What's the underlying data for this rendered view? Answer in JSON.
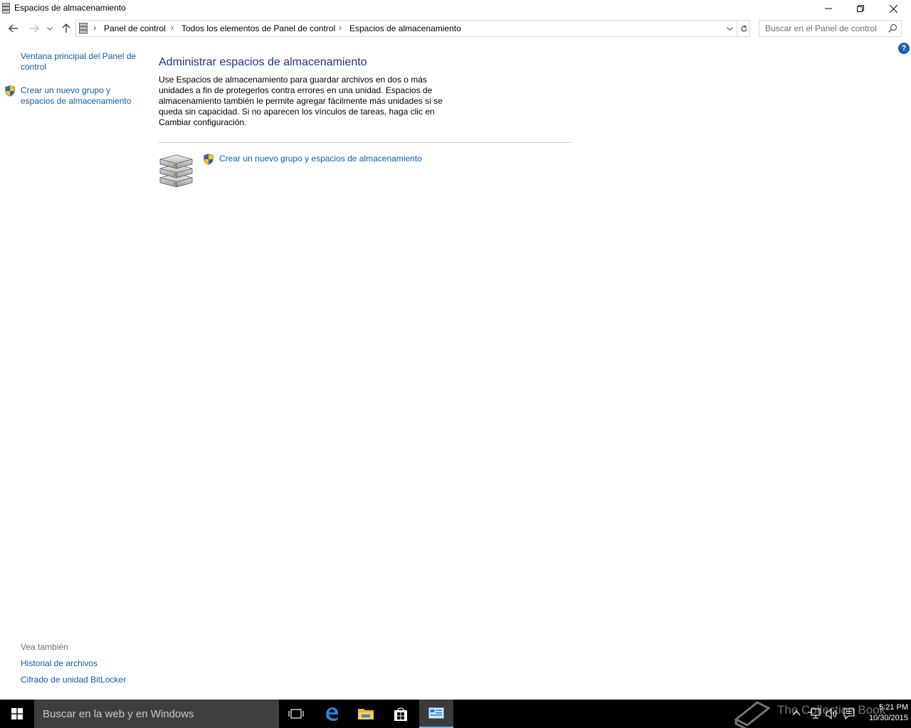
{
  "window": {
    "title": "Espacios de almacenamiento",
    "icon": "storage-spaces-icon"
  },
  "address": {
    "crumbs": [
      "Panel de control",
      "Todos los elementos de Panel de control",
      "Espacios de almacenamiento"
    ],
    "search_placeholder": "Buscar en el Panel de control"
  },
  "left_pane": {
    "home_link": "Ventana principal del Panel de control",
    "create_link": "Crear un nuevo grupo y espacios de almacenamiento",
    "see_also_heading": "Vea también",
    "see_also": [
      "Historial de archivos",
      "Cifrado de unidad BitLocker"
    ]
  },
  "main": {
    "title": "Administrar espacios de almacenamiento",
    "description": "Use Espacios de almacenamiento para guardar archivos en dos o más unidades a fin de protegerlos contra errores en una unidad. Espacios de almacenamiento también le permite agregar fácilmente más unidades si se queda sin capacidad. Si no aparecen los vínculos de tareas, haga clic en Cambiar configuración.",
    "create_link": "Crear un nuevo grupo y espacios de almacenamiento"
  },
  "taskbar": {
    "search_text": "Buscar en la web y en Windows",
    "time": "5:21 PM",
    "date": "10/30/2015",
    "watermark": "The Collection Book"
  },
  "colors": {
    "link": "#0f5ca8",
    "heading": "#1e3287",
    "taskbar": "#000000"
  }
}
